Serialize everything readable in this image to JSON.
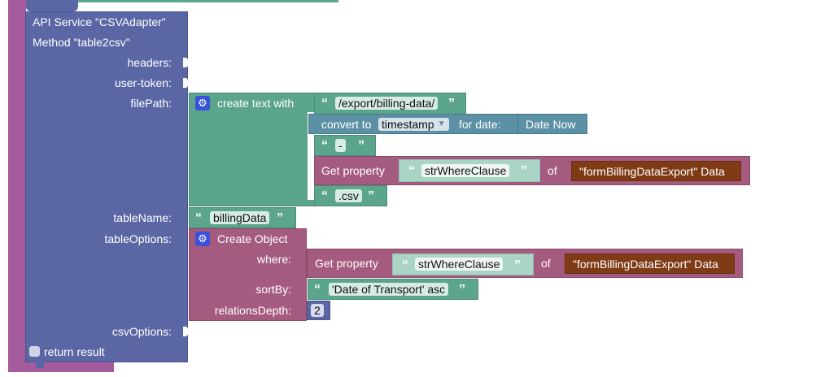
{
  "api_block": {
    "title_line1": "API Service \"CSVAdapter\"",
    "title_line2": "Method \"table2csv\"",
    "inputs": {
      "headers": "headers:",
      "user_token": "user-token:",
      "file_path": "filePath:",
      "table_name": "tableName:",
      "table_options": "tableOptions:",
      "csv_options": "csvOptions:"
    },
    "return_result": "return result"
  },
  "create_text": {
    "label": "create text with",
    "text1": "/export/billing-data/",
    "convert_label": "convert to",
    "convert_option": "timestamp",
    "for_date_label": "for date:",
    "date_now": "Date Now",
    "text_dash": "-",
    "get_property_label": "Get property",
    "property_name": "strWhereClause",
    "of_label": "of",
    "form_data": "\"formBillingDataExport\" Data",
    "text_csv": ".csv"
  },
  "table_name_value": "billingData",
  "create_object": {
    "label": "Create Object",
    "where_label": "where:",
    "get_property_label": "Get property",
    "property_name": "strWhereClause",
    "of_label": "of",
    "form_data": "\"formBillingDataExport\" Data",
    "sort_by_label": "sortBy:",
    "sort_by_value": "'Date of Transport' asc",
    "relations_depth_label": "relationsDepth:",
    "relations_depth_value": "2"
  },
  "colors": {
    "outer_block": "#a55b9e",
    "api_block": "#5b67a5",
    "text_block": "#5ba58c",
    "date_block": "#5b90a5",
    "property_block": "#a55b80",
    "data_block": "#7f3b16",
    "gear": "#3a52d9"
  }
}
